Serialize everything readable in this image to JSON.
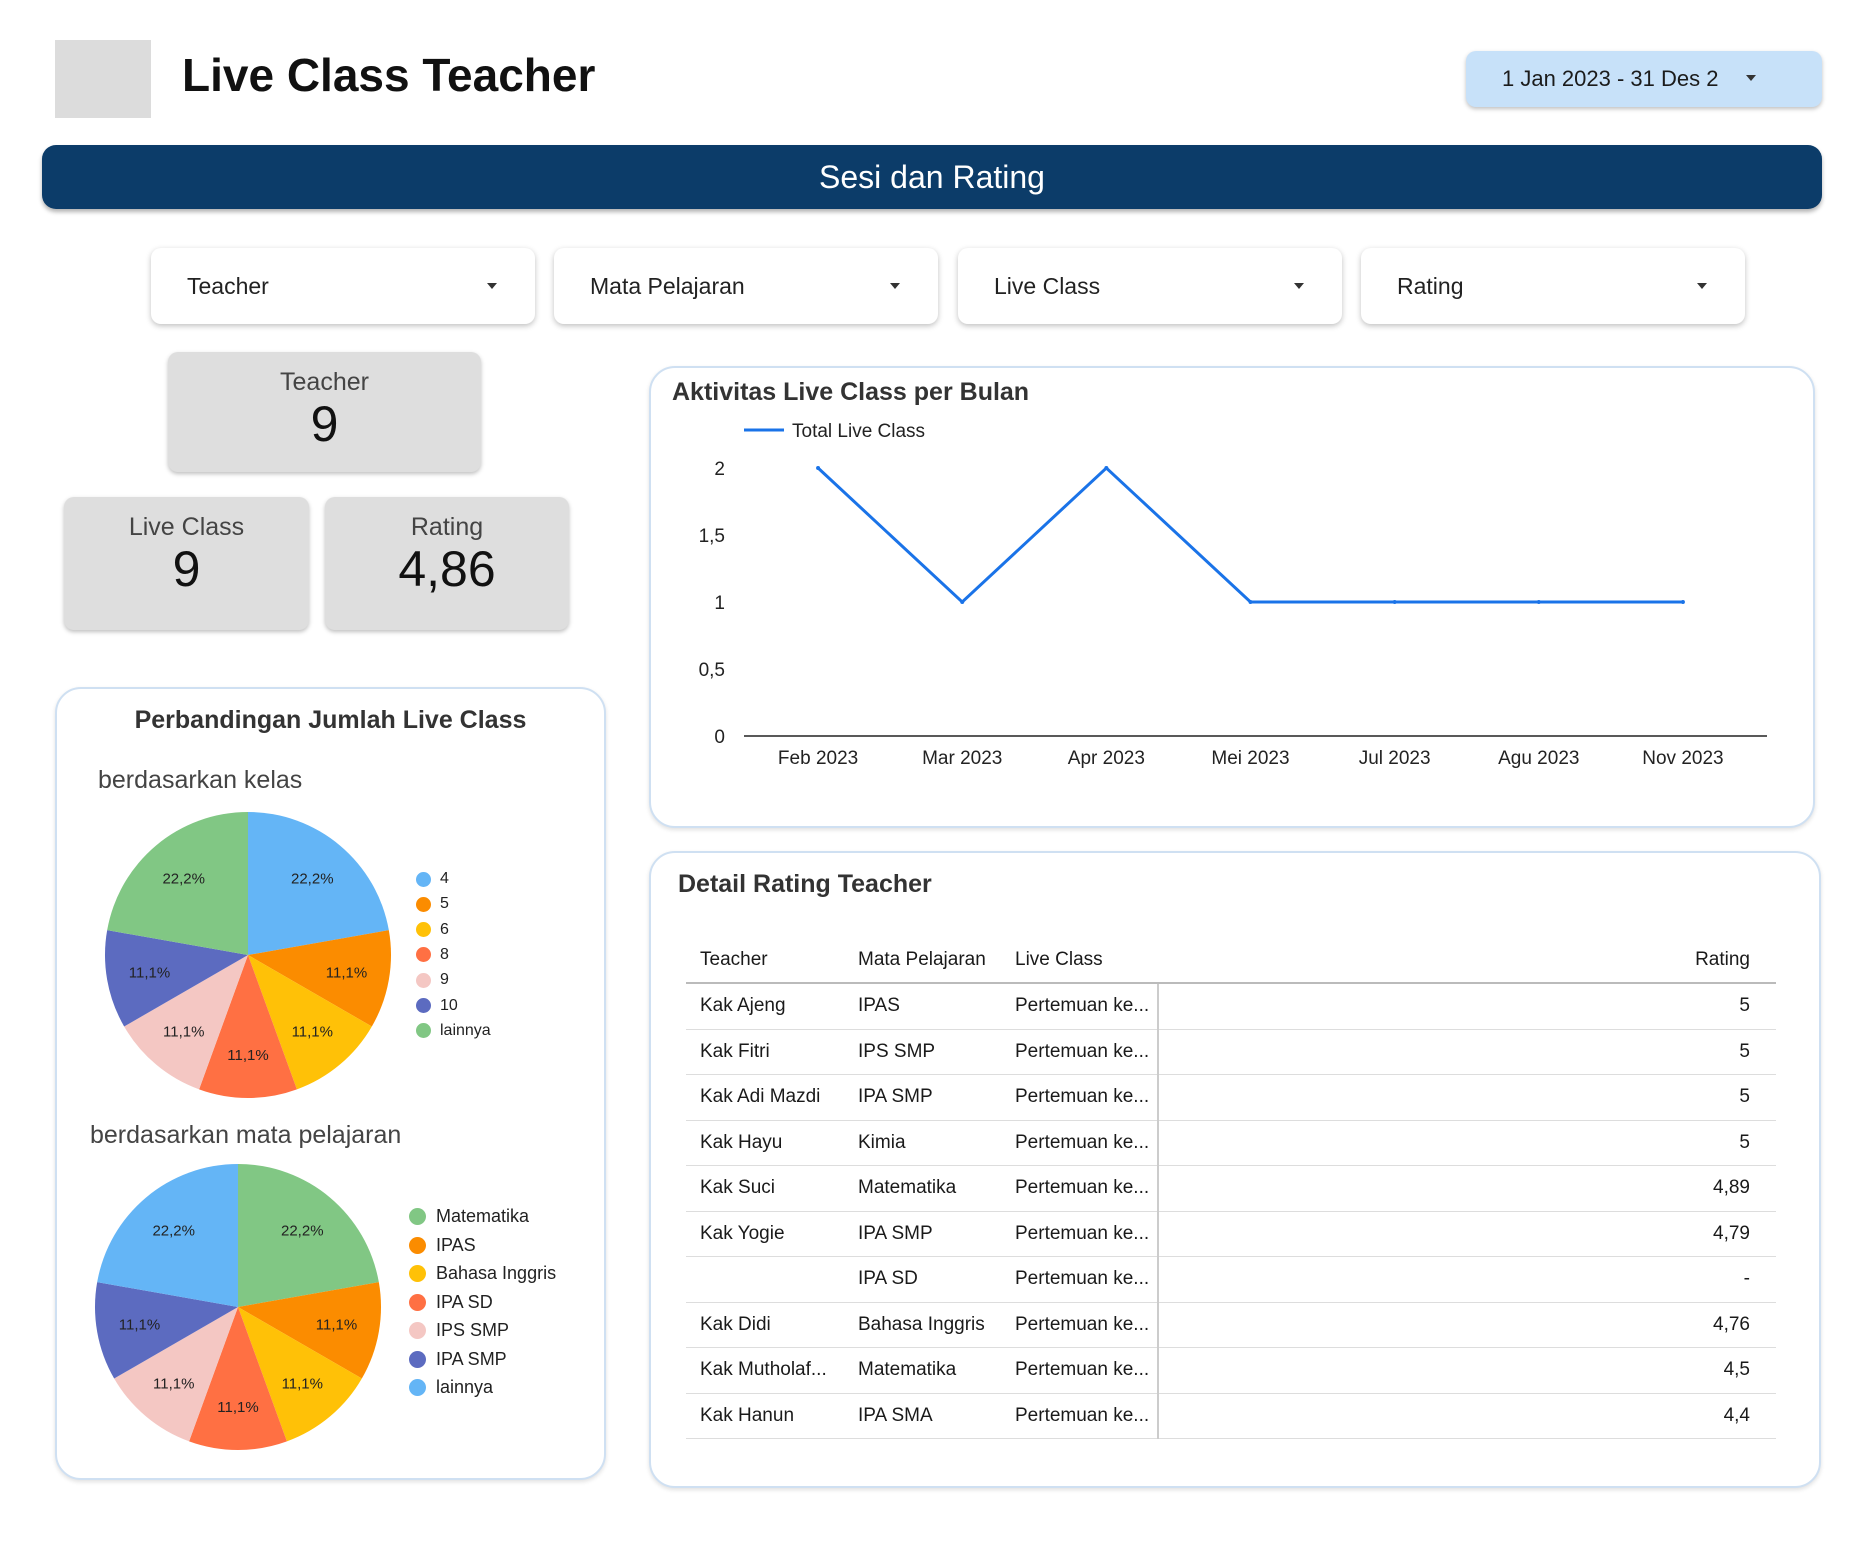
{
  "header": {
    "title": "Live Class Teacher",
    "date_range": "1 Jan 2023 - 31 Des 2"
  },
  "banner": {
    "label": "Sesi dan Rating"
  },
  "filters": [
    {
      "label": "Teacher"
    },
    {
      "label": "Mata Pelajaran"
    },
    {
      "label": "Live Class"
    },
    {
      "label": "Rating"
    }
  ],
  "kpis": {
    "teacher": {
      "label": "Teacher",
      "value": "9"
    },
    "live_class": {
      "label": "Live Class",
      "value": "9"
    },
    "rating": {
      "label": "Rating",
      "value": "4,86"
    }
  },
  "pie_card": {
    "title": "Perbandingan Jumlah Live Class",
    "subtitle_kelas": "berdasarkan kelas",
    "subtitle_mapel": "berdasarkan mata pelajaran"
  },
  "line_card": {
    "title": "Aktivitas Live Class per Bulan"
  },
  "table_card": {
    "title": "Detail Rating Teacher",
    "columns": [
      "Teacher",
      "Mata Pelajaran",
      "Live Class",
      "Rating"
    ],
    "rows": [
      [
        "Kak Ajeng",
        "IPAS",
        "Pertemuan ke...",
        "5"
      ],
      [
        "Kak Fitri",
        "IPS SMP",
        "Pertemuan ke...",
        "5"
      ],
      [
        "Kak Adi Mazdi",
        "IPA SMP",
        "Pertemuan ke...",
        "5"
      ],
      [
        "Kak Hayu",
        "Kimia",
        "Pertemuan ke...",
        "5"
      ],
      [
        "Kak Suci",
        "Matematika",
        "Pertemuan ke...",
        "4,89"
      ],
      [
        "Kak Yogie",
        "IPA SMP",
        "Pertemuan ke...",
        "4,79"
      ],
      [
        "",
        "IPA SD",
        "Pertemuan ke...",
        "-"
      ],
      [
        "Kak Didi",
        "Bahasa Inggris",
        "Pertemuan ke...",
        "4,76"
      ],
      [
        "Kak Mutholaf...",
        "Matematika",
        "Pertemuan ke...",
        "4,5"
      ],
      [
        "Kak Hanun",
        "IPA SMA",
        "Pertemuan ke...",
        "4,4"
      ]
    ]
  },
  "colors": {
    "banner": "#0c3c69",
    "date_pill": "#c7e1f9",
    "line": "#1a73e8"
  },
  "chart_data": [
    {
      "type": "line",
      "title": "Aktivitas Live Class per Bulan",
      "x": [
        "Feb 2023",
        "Mar 2023",
        "Apr 2023",
        "Mei 2023",
        "Jul 2023",
        "Agu 2023",
        "Nov 2023"
      ],
      "series": [
        {
          "name": "Total Live Class",
          "values": [
            2,
            1,
            2,
            1,
            1,
            1,
            1
          ],
          "color": "#1a73e8"
        }
      ],
      "yticks": [
        "0",
        "0,5",
        "1",
        "1,5",
        "2"
      ],
      "ylim": [
        0,
        2
      ],
      "legend": "top-left",
      "grid": false
    },
    {
      "type": "pie",
      "title": "berdasarkan kelas",
      "labels": [
        "4",
        "5",
        "6",
        "8",
        "9",
        "10",
        "lainnya"
      ],
      "values": [
        22.2,
        11.1,
        11.1,
        11.1,
        11.1,
        11.1,
        22.2
      ],
      "value_labels": [
        "22,2%",
        "11,1%",
        "11,1%",
        "11,1%",
        "11,1%",
        "11,1%",
        "22,2%"
      ],
      "colors": [
        "#64b5f6",
        "#fb8c00",
        "#ffc107",
        "#ff7043",
        "#f4c7c3",
        "#5c6bc0",
        "#81c784"
      ],
      "legend": "right"
    },
    {
      "type": "pie",
      "title": "berdasarkan mata pelajaran",
      "labels": [
        "Matematika",
        "IPAS",
        "Bahasa Inggris",
        "IPA SD",
        "IPS SMP",
        "IPA SMP",
        "lainnya"
      ],
      "values": [
        22.2,
        11.1,
        11.1,
        11.1,
        11.1,
        11.1,
        22.2
      ],
      "value_labels": [
        "22,2%",
        "11,1%",
        "11,1%",
        "11,1%",
        "11,1%",
        "11,1%",
        "22,2%"
      ],
      "colors": [
        "#81c784",
        "#fb8c00",
        "#ffc107",
        "#ff7043",
        "#f4c7c3",
        "#5c6bc0",
        "#64b5f6"
      ],
      "legend": "right"
    }
  ]
}
